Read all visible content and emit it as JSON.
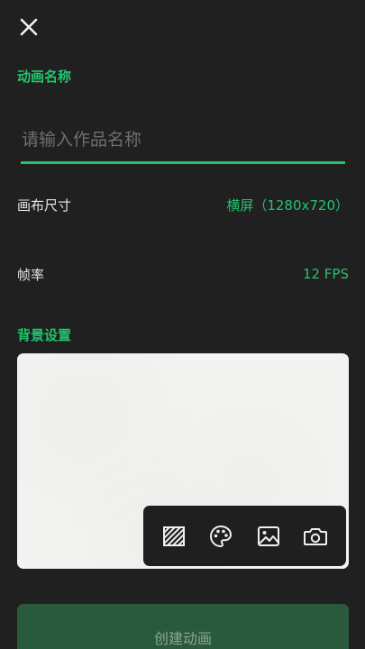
{
  "header": {
    "close_icon": "close-icon"
  },
  "name_section": {
    "label": "动画名称",
    "placeholder": "请输入作品名称",
    "value": ""
  },
  "canvas_size": {
    "label": "画布尺寸",
    "value": "横屏（1280x720）"
  },
  "frame_rate": {
    "label": "帧率",
    "value": "12 FPS"
  },
  "background_section": {
    "label": "背景设置",
    "tools": [
      {
        "icon": "pattern-icon"
      },
      {
        "icon": "palette-icon"
      },
      {
        "icon": "image-icon"
      },
      {
        "icon": "camera-icon"
      }
    ]
  },
  "create_button": {
    "label": "创建动画"
  },
  "colors": {
    "accent": "#22c46e",
    "background": "#202020",
    "button_disabled": "#2a5a3e"
  }
}
